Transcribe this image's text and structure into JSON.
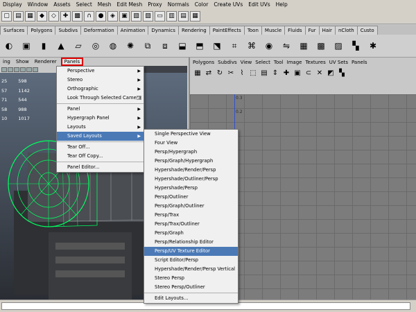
{
  "menubar": [
    "Display",
    "Window",
    "Assets",
    "Select",
    "Mesh",
    "Edit Mesh",
    "Proxy",
    "Normals",
    "Color",
    "Create UVs",
    "Edit UVs",
    "Help"
  ],
  "shelf_tabs": [
    "Surfaces",
    "Polygons",
    "Subdivs",
    "Deformation",
    "Animation",
    "Dynamics",
    "Rendering",
    "PaintEffects",
    "Toon",
    "Muscle",
    "Fluids",
    "Fur",
    "Hair",
    "nCloth",
    "Custo"
  ],
  "left_panel": {
    "menu": [
      "ing",
      "Show",
      "Renderer",
      "Panels"
    ],
    "hud": [
      [
        "25",
        "598"
      ],
      [
        "57",
        "1142"
      ],
      [
        "71",
        "544"
      ],
      [
        "58",
        "988"
      ],
      [
        "10",
        "1017"
      ]
    ]
  },
  "right_panel": {
    "menu": [
      "Polygons",
      "Subdivs",
      "View",
      "Select",
      "Tool",
      "Image",
      "Textures",
      "UV Sets",
      "Panels"
    ],
    "ticks": [
      "0.3",
      "0.2"
    ]
  },
  "panels_menu": {
    "items": [
      {
        "label": "Perspective",
        "arrow": true
      },
      {
        "label": "Stereo",
        "arrow": true
      },
      {
        "label": "Orthographic",
        "arrow": true
      },
      {
        "label": "Look Through Selected Camera",
        "box": true
      },
      {
        "sep": true
      },
      {
        "label": "Panel",
        "arrow": true
      },
      {
        "label": "Hypergraph Panel",
        "arrow": true
      },
      {
        "label": "Layouts",
        "arrow": true
      },
      {
        "label": "Saved Layouts",
        "arrow": true,
        "selected": true
      },
      {
        "sep": true
      },
      {
        "label": "Tear Off..."
      },
      {
        "label": "Tear Off Copy..."
      },
      {
        "sep": true
      },
      {
        "label": "Panel Editor..."
      }
    ]
  },
  "saved_layouts_menu": {
    "items": [
      {
        "label": "Single Perspective View"
      },
      {
        "label": "Four View"
      },
      {
        "label": "Persp/Hypergraph"
      },
      {
        "label": "Persp/Graph/Hypergraph"
      },
      {
        "label": "Hypershade/Render/Persp"
      },
      {
        "label": "Hypershade/Outliner/Persp"
      },
      {
        "label": "Hypershade/Persp"
      },
      {
        "label": "Persp/Outliner"
      },
      {
        "label": "Persp/Graph/Outliner"
      },
      {
        "label": "Persp/Trax"
      },
      {
        "label": "Persp/Trax/Outliner"
      },
      {
        "label": "Persp/Graph"
      },
      {
        "label": "Persp/Relationship Editor"
      },
      {
        "label": "Persp/UV Texture Editor",
        "selected": true
      },
      {
        "label": "Script Editor/Persp"
      },
      {
        "label": "Hypershade/Render/Persp Vertical"
      },
      {
        "label": "Stereo Persp"
      },
      {
        "label": "Stereo Persp/Outliner"
      },
      {
        "sep": true
      },
      {
        "label": "Edit Layouts..."
      }
    ]
  },
  "colors": {
    "accent_selected": "#4a79b6",
    "highlight_box": "#e00000",
    "wireframe": "#00ff60"
  }
}
